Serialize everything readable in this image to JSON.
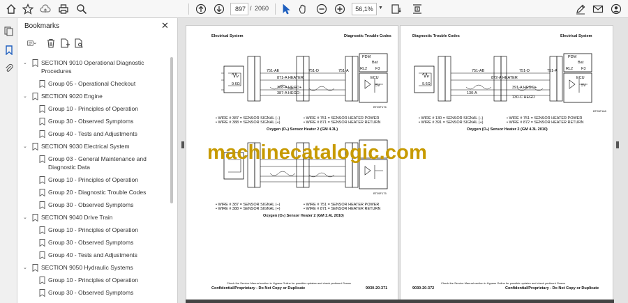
{
  "toolbar": {
    "page_current": "897",
    "page_separator": "/",
    "page_total": "2060",
    "zoom": "56,1%",
    "icons": [
      "home-icon",
      "bookmark-star-icon",
      "cloud-upload-icon",
      "print-icon",
      "zoom-search-icon",
      "page-up-icon",
      "page-down-icon",
      "select-cursor-icon",
      "hand-icon",
      "zoom-out-icon",
      "zoom-in-icon",
      "fit-page-icon",
      "scroll-mode-icon",
      "edit-sign-icon",
      "email-icon",
      "user-icon"
    ]
  },
  "bookmarks": {
    "title": "Bookmarks",
    "items": [
      {
        "label": "SECTION 9010 Operational Diagnostic",
        "label2": "Procedures",
        "level": 0
      },
      {
        "label": "Group 05 - Operational Checkout",
        "level": 1
      },
      {
        "label": "SECTION 9020 Engine",
        "level": 0
      },
      {
        "label": "Group 10 - Principles of Operation",
        "level": 1
      },
      {
        "label": "Group 30 - Observed Symptoms",
        "level": 1
      },
      {
        "label": "Group 40 - Tests and Adjustments",
        "level": 1
      },
      {
        "label": "SECTION 9030 Electrical System",
        "level": 0
      },
      {
        "label": "Group 03 - General Maintenance and",
        "label2": "Diagnostic Data",
        "level": 1
      },
      {
        "label": "Group 10 - Principles of Operation",
        "level": 1
      },
      {
        "label": "Group 20 - Diagnostic Trouble Codes",
        "level": 1
      },
      {
        "label": "Group 30 - Observed Symptoms",
        "level": 1
      },
      {
        "label": "SECTION 9040 Drive Train",
        "level": 0
      },
      {
        "label": "Group 10 - Principles of Operation",
        "level": 1
      },
      {
        "label": "Group 30 - Observed Symptoms",
        "level": 1
      },
      {
        "label": "Group 40 - Tests and Adjustments",
        "level": 1
      },
      {
        "label": "SECTION 9050 Hydraulic Systems",
        "level": 0
      },
      {
        "label": "Group 10 - Principles of Operation",
        "level": 1
      },
      {
        "label": "Group 30 - Observed Symptoms",
        "level": 1
      }
    ]
  },
  "left_page": {
    "header_left": "Electrical System",
    "header_right": "Diagnostic Trouble Codes",
    "diagram1": {
      "pdm": "PDM",
      "bat": "Bat",
      "rl2": "RL2",
      "f3": "F3",
      "ecu": "ECU",
      "v5": "5V",
      "r_label": "9.6Ω",
      "wire_751ae": "751-AE",
      "wire_751d": "751-D",
      "wire_751a": "751-A",
      "wire_871a": "871-A HEATER",
      "wire_388a": "388-A HEGO+",
      "wire_387a": "387-A HEGO-",
      "ref": "BT05F176",
      "legend": [
        "• WIRE # 387 = SENSOR SIGNAL (–)",
        "• WIRE # 388 = SENSOR SIGNAL (+)",
        "• WIRE # 751 = SENSOR HEATER POWER",
        "• WIRE # 871 = SENSOR HEATER RETURN"
      ],
      "caption": "Oxygen (O₂) Sensor Heater 2 (GM 4.3L)"
    },
    "diagram2": {
      "ref": "BT05F175",
      "legend": [
        "• WIRE # 387 = SENSOR SIGNAL (–)",
        "• WIRE # 388 = SENSOR SIGNAL (+)",
        "• WIRE # 751 = SENSOR HEATER POWER",
        "• WIRE # 871 = SENSOR HEATER RETURN"
      ],
      "caption": "Oxygen (O₂) Sensor Heater 2 (GM 2.4L 2010)"
    },
    "footer_note": "Check the Service Manual section in Hypass Online for possible updates and check pertinent Grams",
    "footer_conf": "Confidential/Proprietary - Do Not Copy or Duplicate",
    "footer_page": "9030-20-371"
  },
  "right_page": {
    "header_left": "Diagnostic Trouble Codes",
    "header_right": "Electrical System",
    "diagram": {
      "pdm": "PDM",
      "bat": "Bat",
      "rl2": "RL2",
      "f3": "F3",
      "ecu": "ECU",
      "v5": "5V",
      "r_label": "9.6Ω",
      "wire_751ab": "751-AB",
      "wire_751d": "751-D",
      "wire_751a": "751-A",
      "wire_872a": "872-A HEATER",
      "wire_391a": "391-A HEGO+",
      "wire_130a": "130-A",
      "wire_130c": "130-C HEGO",
      "ref": "BT05F168",
      "legend": [
        "• WIRE # 130 = SENSOR SIGNAL (–)",
        "• WIRE # 391 = SENSOR SIGNAL (+)",
        "• WIRE # 751 = SENSOR HEATER POWER",
        "• WIRE # 872 = SENSOR HEATER RETURN"
      ],
      "caption": "Oxygen (O₂) Sensor Heater 2 (GM 4.3L 2010)"
    },
    "footer_note": "Check the Service Manual section in Hypass Online for possible updates and check pertinent Grams",
    "footer_page": "9030-20-372",
    "footer_conf": "Confidential/Proprietary - Do Not Copy or Duplicate"
  },
  "watermark": "machinecatalogic.com"
}
